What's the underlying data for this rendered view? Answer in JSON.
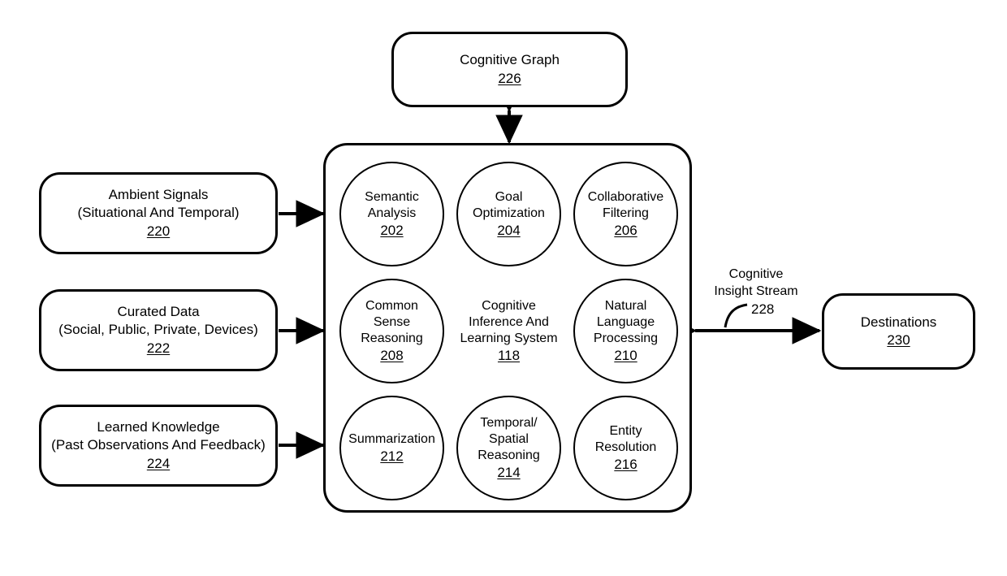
{
  "figure": {
    "title": "Cognitive Inference And Learning System block diagram",
    "line_color": "#000000",
    "background": "#ffffff"
  },
  "top_store": {
    "label": "Cognitive Graph",
    "ref": "226"
  },
  "inputs": [
    {
      "name": "ambient-signals",
      "line1": "Ambient Signals",
      "line2": "(Situational And Temporal)",
      "ref": "220"
    },
    {
      "name": "curated-data",
      "line1": "Curated Data",
      "line2": "(Social, Public, Private, Devices)",
      "ref": "222"
    },
    {
      "name": "learned-knowledge",
      "line1": "Learned Knowledge",
      "line2": "(Past Observations And Feedback)",
      "ref": "224"
    }
  ],
  "system": {
    "center_label_line1": "Cognitive",
    "center_label_line2": "Inference And",
    "center_label_line3": "Learning System",
    "center_ref": "118",
    "modules": [
      {
        "name": "semantic-analysis",
        "line1": "Semantic",
        "line2": "Analysis",
        "line3": "",
        "ref": "202"
      },
      {
        "name": "goal-optimization",
        "line1": "Goal",
        "line2": "Optimization",
        "line3": "",
        "ref": "204"
      },
      {
        "name": "collaborative-filtering",
        "line1": "Collaborative",
        "line2": "Filtering",
        "line3": "",
        "ref": "206"
      },
      {
        "name": "common-sense-reasoning",
        "line1": "Common",
        "line2": "Sense",
        "line3": "Reasoning",
        "ref": "208"
      },
      {
        "name": "natural-language-processing",
        "line1": "Natural",
        "line2": "Language",
        "line3": "Processing",
        "ref": "210"
      },
      {
        "name": "summarization",
        "line1": "Summarization",
        "line2": "",
        "line3": "",
        "ref": "212"
      },
      {
        "name": "temporal-spatial-reasoning",
        "line1": "Temporal/",
        "line2": "Spatial",
        "line3": "Reasoning",
        "ref": "214"
      },
      {
        "name": "entity-resolution",
        "line1": "Entity",
        "line2": "Resolution",
        "line3": "",
        "ref": "216"
      }
    ]
  },
  "output_stream": {
    "line1": "Cognitive",
    "line2": "Insight Stream",
    "ref": "228"
  },
  "destinations": {
    "label": "Destinations",
    "ref": "230"
  }
}
